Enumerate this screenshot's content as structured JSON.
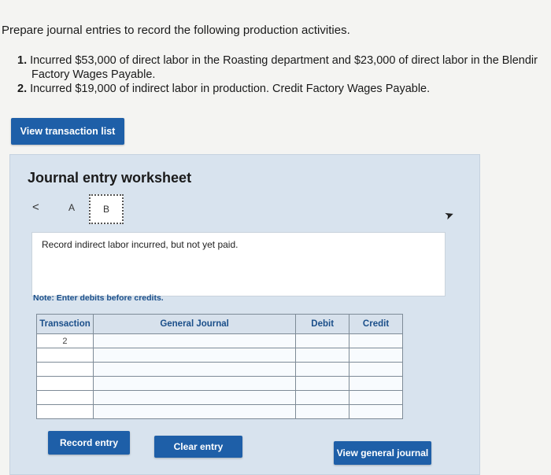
{
  "prompt": "Prepare journal entries to record the following production activities.",
  "tasks": [
    {
      "num": "1.",
      "line1": "Incurred $53,000 of direct labor in the Roasting department and $23,000 of direct labor in the Blendir",
      "line2": "Factory Wages Payable."
    },
    {
      "num": "2.",
      "line1": "Incurred $19,000 of indirect labor in production. Credit Factory Wages Payable."
    }
  ],
  "buttons": {
    "view_transactions": "View transaction list",
    "record_entry": "Record entry",
    "clear_entry": "Clear entry",
    "view_general_journal": "View general journal"
  },
  "worksheet": {
    "title": "Journal entry worksheet",
    "nav_prev": "<",
    "tabs": [
      "A",
      "B"
    ],
    "active_tab": "B",
    "instruction": "Record indirect labor incurred, but not yet paid.",
    "note": "Note: Enter debits before credits.",
    "table": {
      "headers": [
        "Transaction",
        "General Journal",
        "Debit",
        "Credit"
      ],
      "rows": [
        {
          "transaction": "2"
        },
        {
          "transaction": ""
        },
        {
          "transaction": ""
        },
        {
          "transaction": ""
        },
        {
          "transaction": ""
        },
        {
          "transaction": ""
        }
      ]
    }
  },
  "colors": {
    "button_bg": "#1e5fa8",
    "worksheet_bg": "#d8e3ee",
    "header_text": "#1b4f8a"
  }
}
